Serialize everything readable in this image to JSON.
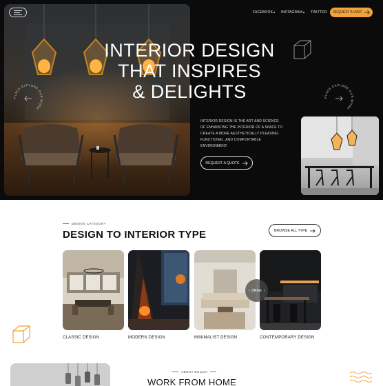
{
  "header": {
    "menu_icon": "hamburger-icon",
    "social_links": [
      "FACEBOOK",
      "INSTAGRAM",
      "TWITTER"
    ],
    "cta_label": "REQUEST A VISIT",
    "cta_icon": "arrow-right-icon"
  },
  "hero": {
    "title_lines": [
      "INTERIOR DESIGN",
      "THAT INSPIRES",
      "& DELIGHTS"
    ],
    "description": "INTERIOR DESIGN IS THE ART AND SCIENCE OF ENHANCING THE INTERIOR OF A SPACE TO CREATE A MORE AESTHETICALLY PLEASING FUNCTIONAL, AND COMFORTABLE ENVIRONMENT.",
    "cta_label": "REQUEST A QUOTE",
    "cta_icon": "arrow-right-icon",
    "badge_text": "PLACE EXPLORE OUR WORK ",
    "decor_icon": "cube-outline-icon"
  },
  "category": {
    "eyebrow": "DESIGN CATEGORY",
    "title": "DESIGN TO INTERIOR TYPE",
    "browse_label": "BROWSE ALL TYPE",
    "drag_label": "DRAG",
    "cards": [
      {
        "label": "CLASSIC DESIGN"
      },
      {
        "label": "MODERN DESIGN"
      },
      {
        "label": "MINIMALIST DESIGN"
      },
      {
        "label": "CONTEMPORARY DESIGN"
      }
    ]
  },
  "about": {
    "eyebrow": "ABOUT BUILDA",
    "title": "WORK FROM HOME"
  },
  "colors": {
    "accent": "#f2a23a",
    "hero_bg": "#0b0b0b",
    "page_bg": "#ffffff"
  }
}
